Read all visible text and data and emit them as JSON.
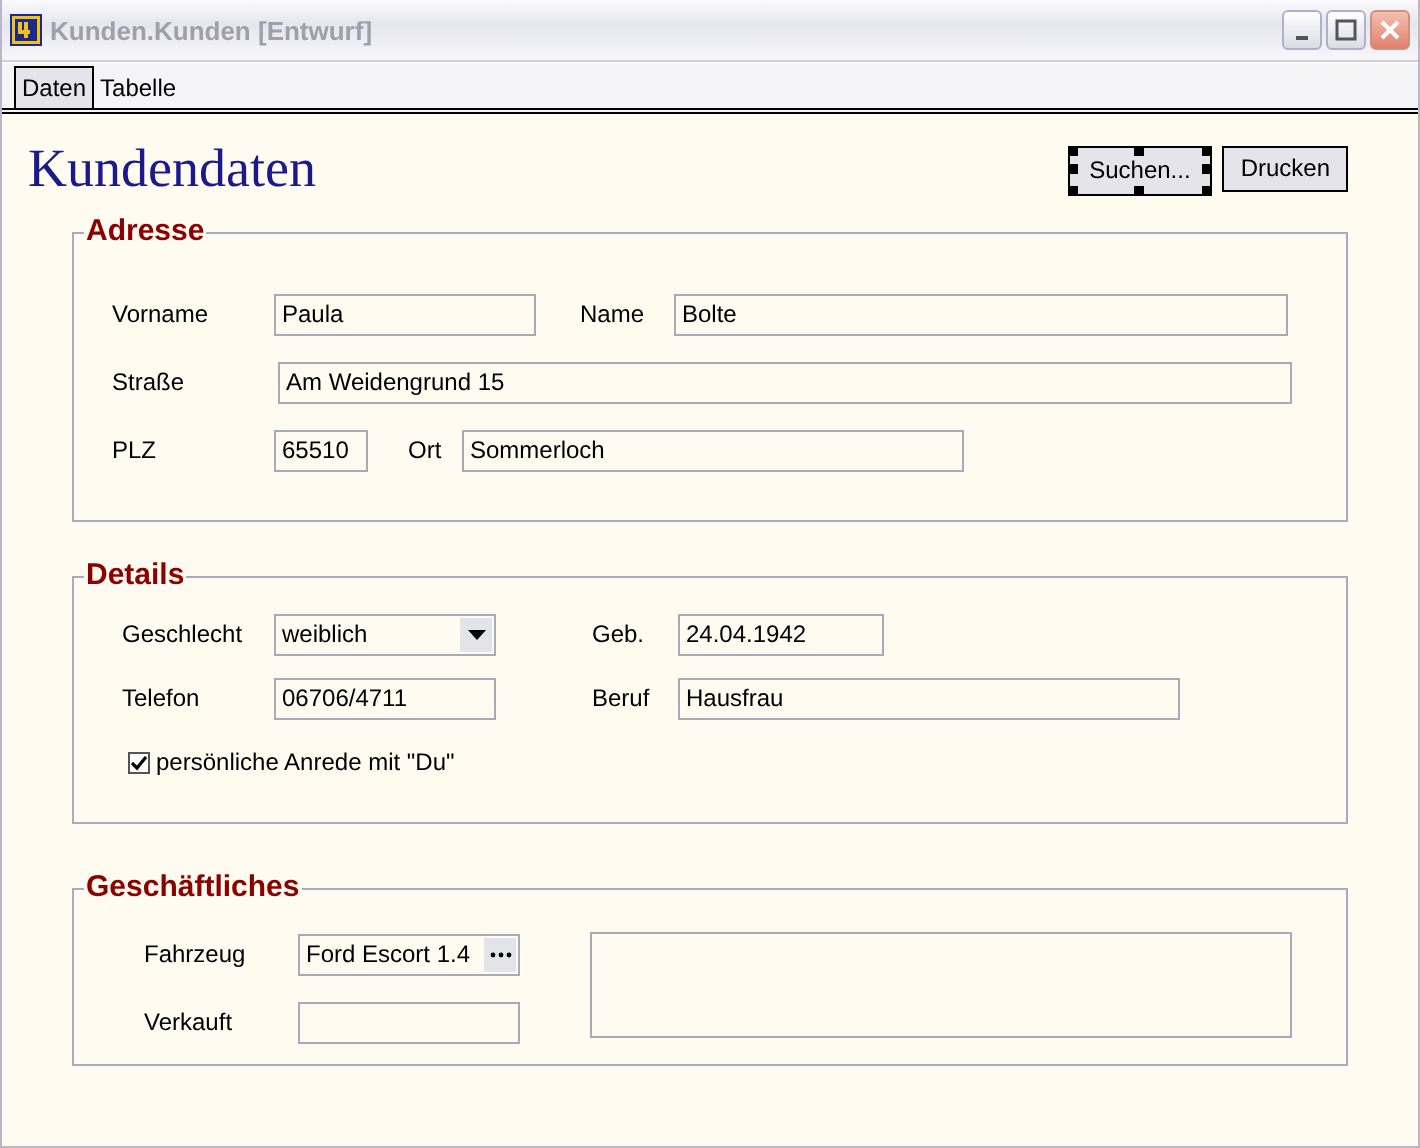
{
  "window": {
    "title": "Kunden.Kunden [Entwurf]"
  },
  "tabs": [
    {
      "label": "Daten",
      "selected": true
    },
    {
      "label": "Tabelle",
      "selected": false
    }
  ],
  "heading": "Kundendaten",
  "buttons": [
    {
      "label": "Suchen...",
      "selected": true
    },
    {
      "label": "Drucken",
      "selected": false
    }
  ],
  "sections": [
    {
      "title": "Adresse",
      "rows": [
        [
          {
            "kind": "text",
            "label": "Vorname",
            "value": "Paula"
          },
          {
            "kind": "text",
            "label": "Name",
            "value": "Bolte"
          }
        ],
        [
          {
            "kind": "text",
            "label": "Straße",
            "value": "Am Weidengrund 15"
          }
        ],
        [
          {
            "kind": "text",
            "label": "PLZ",
            "value": "65510"
          },
          {
            "kind": "text",
            "label": "Ort",
            "value": "Sommerloch"
          }
        ]
      ]
    },
    {
      "title": "Details",
      "rows": [
        [
          {
            "kind": "select",
            "label": "Geschlecht",
            "value": "weiblich"
          },
          {
            "kind": "text",
            "label": "Geb.",
            "value": "24.04.1942"
          }
        ],
        [
          {
            "kind": "text",
            "label": "Telefon",
            "value": "06706/4711"
          },
          {
            "kind": "text",
            "label": "Beruf",
            "value": "Hausfrau"
          }
        ],
        [
          {
            "kind": "checkbox",
            "label": "persönliche Anrede mit \"Du\"",
            "checked": true
          }
        ]
      ]
    },
    {
      "title": "Geschäftliches",
      "rows": [
        [
          {
            "kind": "lookup",
            "label": "Fahrzeug",
            "value": "Ford Escort 1.4"
          }
        ],
        [
          {
            "kind": "text",
            "label": "Verkauft"
          }
        ]
      ],
      "memo": {
        "kind": "memo"
      }
    }
  ]
}
